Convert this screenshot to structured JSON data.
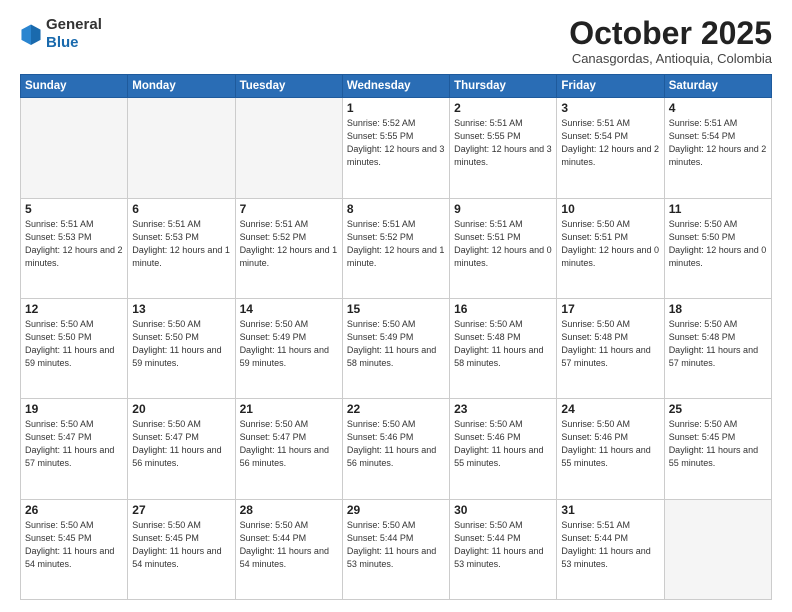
{
  "header": {
    "logo_general": "General",
    "logo_blue": "Blue",
    "month_title": "October 2025",
    "location": "Canasgordas, Antioquia, Colombia"
  },
  "weekdays": [
    "Sunday",
    "Monday",
    "Tuesday",
    "Wednesday",
    "Thursday",
    "Friday",
    "Saturday"
  ],
  "weeks": [
    [
      {
        "day": "",
        "info": ""
      },
      {
        "day": "",
        "info": ""
      },
      {
        "day": "",
        "info": ""
      },
      {
        "day": "1",
        "info": "Sunrise: 5:52 AM\nSunset: 5:55 PM\nDaylight: 12 hours\nand 3 minutes."
      },
      {
        "day": "2",
        "info": "Sunrise: 5:51 AM\nSunset: 5:55 PM\nDaylight: 12 hours\nand 3 minutes."
      },
      {
        "day": "3",
        "info": "Sunrise: 5:51 AM\nSunset: 5:54 PM\nDaylight: 12 hours\nand 2 minutes."
      },
      {
        "day": "4",
        "info": "Sunrise: 5:51 AM\nSunset: 5:54 PM\nDaylight: 12 hours\nand 2 minutes."
      }
    ],
    [
      {
        "day": "5",
        "info": "Sunrise: 5:51 AM\nSunset: 5:53 PM\nDaylight: 12 hours\nand 2 minutes."
      },
      {
        "day": "6",
        "info": "Sunrise: 5:51 AM\nSunset: 5:53 PM\nDaylight: 12 hours\nand 1 minute."
      },
      {
        "day": "7",
        "info": "Sunrise: 5:51 AM\nSunset: 5:52 PM\nDaylight: 12 hours\nand 1 minute."
      },
      {
        "day": "8",
        "info": "Sunrise: 5:51 AM\nSunset: 5:52 PM\nDaylight: 12 hours\nand 1 minute."
      },
      {
        "day": "9",
        "info": "Sunrise: 5:51 AM\nSunset: 5:51 PM\nDaylight: 12 hours\nand 0 minutes."
      },
      {
        "day": "10",
        "info": "Sunrise: 5:50 AM\nSunset: 5:51 PM\nDaylight: 12 hours\nand 0 minutes."
      },
      {
        "day": "11",
        "info": "Sunrise: 5:50 AM\nSunset: 5:50 PM\nDaylight: 12 hours\nand 0 minutes."
      }
    ],
    [
      {
        "day": "12",
        "info": "Sunrise: 5:50 AM\nSunset: 5:50 PM\nDaylight: 11 hours\nand 59 minutes."
      },
      {
        "day": "13",
        "info": "Sunrise: 5:50 AM\nSunset: 5:50 PM\nDaylight: 11 hours\nand 59 minutes."
      },
      {
        "day": "14",
        "info": "Sunrise: 5:50 AM\nSunset: 5:49 PM\nDaylight: 11 hours\nand 59 minutes."
      },
      {
        "day": "15",
        "info": "Sunrise: 5:50 AM\nSunset: 5:49 PM\nDaylight: 11 hours\nand 58 minutes."
      },
      {
        "day": "16",
        "info": "Sunrise: 5:50 AM\nSunset: 5:48 PM\nDaylight: 11 hours\nand 58 minutes."
      },
      {
        "day": "17",
        "info": "Sunrise: 5:50 AM\nSunset: 5:48 PM\nDaylight: 11 hours\nand 57 minutes."
      },
      {
        "day": "18",
        "info": "Sunrise: 5:50 AM\nSunset: 5:48 PM\nDaylight: 11 hours\nand 57 minutes."
      }
    ],
    [
      {
        "day": "19",
        "info": "Sunrise: 5:50 AM\nSunset: 5:47 PM\nDaylight: 11 hours\nand 57 minutes."
      },
      {
        "day": "20",
        "info": "Sunrise: 5:50 AM\nSunset: 5:47 PM\nDaylight: 11 hours\nand 56 minutes."
      },
      {
        "day": "21",
        "info": "Sunrise: 5:50 AM\nSunset: 5:47 PM\nDaylight: 11 hours\nand 56 minutes."
      },
      {
        "day": "22",
        "info": "Sunrise: 5:50 AM\nSunset: 5:46 PM\nDaylight: 11 hours\nand 56 minutes."
      },
      {
        "day": "23",
        "info": "Sunrise: 5:50 AM\nSunset: 5:46 PM\nDaylight: 11 hours\nand 55 minutes."
      },
      {
        "day": "24",
        "info": "Sunrise: 5:50 AM\nSunset: 5:46 PM\nDaylight: 11 hours\nand 55 minutes."
      },
      {
        "day": "25",
        "info": "Sunrise: 5:50 AM\nSunset: 5:45 PM\nDaylight: 11 hours\nand 55 minutes."
      }
    ],
    [
      {
        "day": "26",
        "info": "Sunrise: 5:50 AM\nSunset: 5:45 PM\nDaylight: 11 hours\nand 54 minutes."
      },
      {
        "day": "27",
        "info": "Sunrise: 5:50 AM\nSunset: 5:45 PM\nDaylight: 11 hours\nand 54 minutes."
      },
      {
        "day": "28",
        "info": "Sunrise: 5:50 AM\nSunset: 5:44 PM\nDaylight: 11 hours\nand 54 minutes."
      },
      {
        "day": "29",
        "info": "Sunrise: 5:50 AM\nSunset: 5:44 PM\nDaylight: 11 hours\nand 53 minutes."
      },
      {
        "day": "30",
        "info": "Sunrise: 5:50 AM\nSunset: 5:44 PM\nDaylight: 11 hours\nand 53 minutes."
      },
      {
        "day": "31",
        "info": "Sunrise: 5:51 AM\nSunset: 5:44 PM\nDaylight: 11 hours\nand 53 minutes."
      },
      {
        "day": "",
        "info": ""
      }
    ]
  ]
}
